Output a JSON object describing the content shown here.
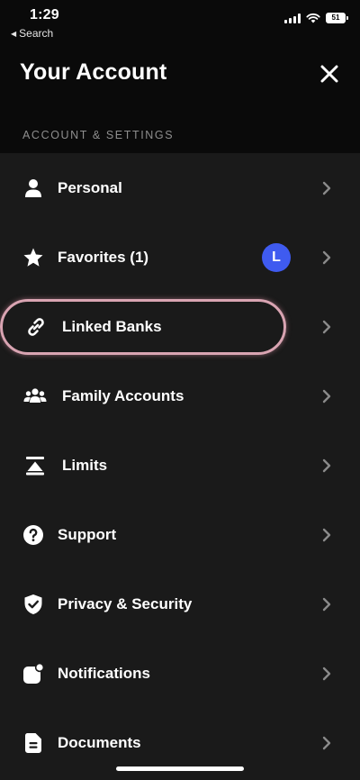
{
  "status_bar": {
    "time": "1:29",
    "back_label": "Search",
    "battery": "51"
  },
  "header": {
    "title": "Your Account",
    "close_icon": "close-icon"
  },
  "section": {
    "label": "ACCOUNT & SETTINGS"
  },
  "menu": {
    "items": [
      {
        "label": "Personal",
        "icon": "person-icon"
      },
      {
        "label": "Favorites (1)",
        "icon": "star-icon",
        "badge": "L"
      },
      {
        "label": "Linked Banks",
        "icon": "link-icon",
        "highlighted": true
      },
      {
        "label": "Family Accounts",
        "icon": "family-icon"
      },
      {
        "label": "Limits",
        "icon": "limits-icon"
      },
      {
        "label": "Support",
        "icon": "help-icon"
      },
      {
        "label": "Privacy & Security",
        "icon": "shield-check-icon"
      },
      {
        "label": "Notifications",
        "icon": "notification-icon"
      },
      {
        "label": "Documents",
        "icon": "document-icon"
      }
    ]
  },
  "colors": {
    "background": "#0a0a0a",
    "menu_background": "#1a1a1a",
    "badge": "#3f5bf0",
    "highlight_ring": "#d9a4b2",
    "section_label": "#8e8e8e"
  }
}
